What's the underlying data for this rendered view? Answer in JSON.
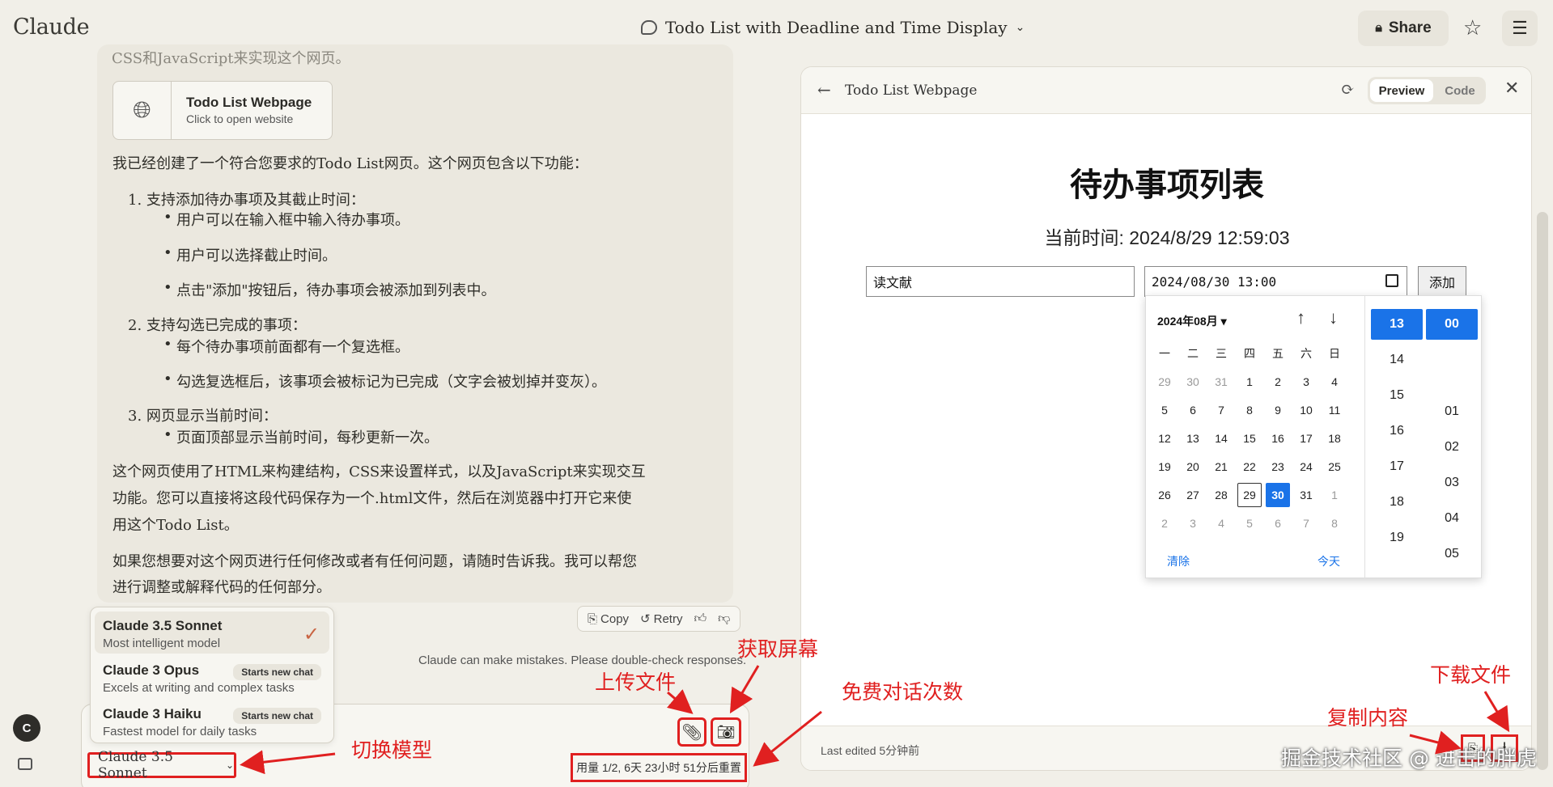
{
  "app": {
    "logo": "Claude",
    "conversation_title": "Todo List with Deadline and Time Display",
    "share_label": "Share"
  },
  "conversation": {
    "top_line": "CSS和JavaScript来实现这个网页。",
    "artifact": {
      "title": "Todo List Webpage",
      "subtitle": "Click to open website"
    },
    "intro": "我已经创建了一个符合您要求的Todo List网页。这个网页包含以下功能：",
    "sections": [
      {
        "title": "1. 支持添加待办事项及其截止时间：",
        "bullets": [
          "用户可以在输入框中输入待办事项。",
          "用户可以选择截止时间。",
          "点击\"添加\"按钮后，待办事项会被添加到列表中。"
        ]
      },
      {
        "title": "2. 支持勾选已完成的事项：",
        "bullets": [
          "每个待办事项前面都有一个复选框。",
          "勾选复选框后，该事项会被标记为已完成（文字会被划掉并变灰）。"
        ]
      },
      {
        "title": "3. 网页显示当前时间：",
        "bullets": [
          "页面顶部显示当前时间，每秒更新一次。"
        ]
      }
    ],
    "para1_l1": "这个网页使用了HTML来构建结构，CSS来设置样式，以及JavaScript来实现交互",
    "para1_l2": "功能。您可以直接将这段代码保存为一个.html文件，然后在浏览器中打开它来使",
    "para1_l3": "用这个Todo List。",
    "para2_l1": "如果您想要对这个网页进行任何修改或者有任何问题，请随时告诉我。我可以帮您",
    "para2_l2": "进行调整或解释代码的任何部分。",
    "actions": {
      "copy": "Copy",
      "retry": "Retry"
    },
    "disclaimer": "Claude can make mistakes. Please double-check responses."
  },
  "model_menu": [
    {
      "name": "Claude 3.5 Sonnet",
      "desc": "Most intelligent model",
      "badge": ""
    },
    {
      "name": "Claude 3 Opus",
      "desc": "Excels at writing and complex tasks",
      "badge": "Starts new chat"
    },
    {
      "name": "Claude 3 Haiku",
      "desc": "Fastest model for daily tasks",
      "badge": "Starts new chat"
    }
  ],
  "input": {
    "model_select": "Claude 3.5 Sonnet",
    "usage": "用量 1/2, 6天 23小时 51分后重置"
  },
  "user": {
    "avatar_letter": "C"
  },
  "preview": {
    "title": "Todo List Webpage",
    "tab_preview": "Preview",
    "tab_code": "Code",
    "heading": "待办事项列表",
    "current_time": "当前时间: 2024/8/29 12:59:03",
    "todo_value": "读文献",
    "date_value": "2024/08/30 13:00",
    "add_label": "添加",
    "datepicker": {
      "month_label": "2024年08月 ▾",
      "weekdays": [
        "一",
        "二",
        "三",
        "四",
        "五",
        "六",
        "日"
      ],
      "weeks": [
        [
          "29",
          "30",
          "31",
          "1",
          "2",
          "3",
          "4"
        ],
        [
          "5",
          "6",
          "7",
          "8",
          "9",
          "10",
          "11"
        ],
        [
          "12",
          "13",
          "14",
          "15",
          "16",
          "17",
          "18"
        ],
        [
          "19",
          "20",
          "21",
          "22",
          "23",
          "24",
          "25"
        ],
        [
          "26",
          "27",
          "28",
          "29",
          "30",
          "31",
          "1"
        ],
        [
          "2",
          "3",
          "4",
          "5",
          "6",
          "7",
          "8"
        ]
      ],
      "clear": "清除",
      "today": "今天",
      "hours": [
        "13",
        "14",
        "15",
        "16",
        "17",
        "18",
        "19"
      ],
      "minutes": [
        "00",
        "01",
        "02",
        "03",
        "04",
        "05"
      ]
    },
    "last_edited": "Last edited 5分钟前"
  },
  "annotations": {
    "switch_model": "切换模型",
    "upload_file": "上传文件",
    "screenshot": "获取屏幕",
    "free_count": "免费对话次数",
    "copy_content": "复制内容",
    "download_file": "下载文件",
    "watermark": "掘金技术社区 @ 进击的胖虎"
  },
  "colors": {
    "annotation": "#e02020",
    "accent": "#1a73e8",
    "background": "#f1efe8"
  }
}
